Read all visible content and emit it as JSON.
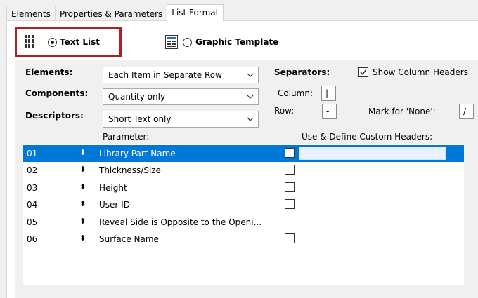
{
  "tabs": [
    {
      "label": "Elements"
    },
    {
      "label": "Properties & Parameters"
    },
    {
      "label": "List Format"
    }
  ],
  "mode": {
    "text_list": "Text List",
    "graphic_template": "Graphic Template",
    "selected": "Text List"
  },
  "settings": {
    "elements_label": "Elements:",
    "elements_value": "Each Item in Separate Row",
    "components_label": "Components:",
    "components_value": "Quantity only",
    "descriptors_label": "Descriptors:",
    "descriptors_value": "Short Text only",
    "separators_label": "Separators:",
    "column_label": "Column:",
    "column_value": "|",
    "row_label": "Row:",
    "row_value": "-",
    "show_headers_label": "Show Column Headers",
    "show_headers_checked": true,
    "mark_none_label": "Mark for 'None':",
    "mark_none_value": "/"
  },
  "list": {
    "parameter_header": "Parameter:",
    "custom_header": "Use & Define Custom Headers:",
    "rows": [
      {
        "num": "01",
        "name": "Library Part Name",
        "selected": true
      },
      {
        "num": "02",
        "name": "Thickness/Size",
        "selected": false
      },
      {
        "num": "03",
        "name": "Height",
        "selected": false
      },
      {
        "num": "04",
        "name": "User ID",
        "selected": false
      },
      {
        "num": "05",
        "name": "Reveal Side is Opposite to the Openi...",
        "selected": false
      },
      {
        "num": "06",
        "name": "Surface Name",
        "selected": false
      }
    ]
  },
  "colors": {
    "selection": "#0078d7",
    "highlight_border": "#b01e1e"
  }
}
